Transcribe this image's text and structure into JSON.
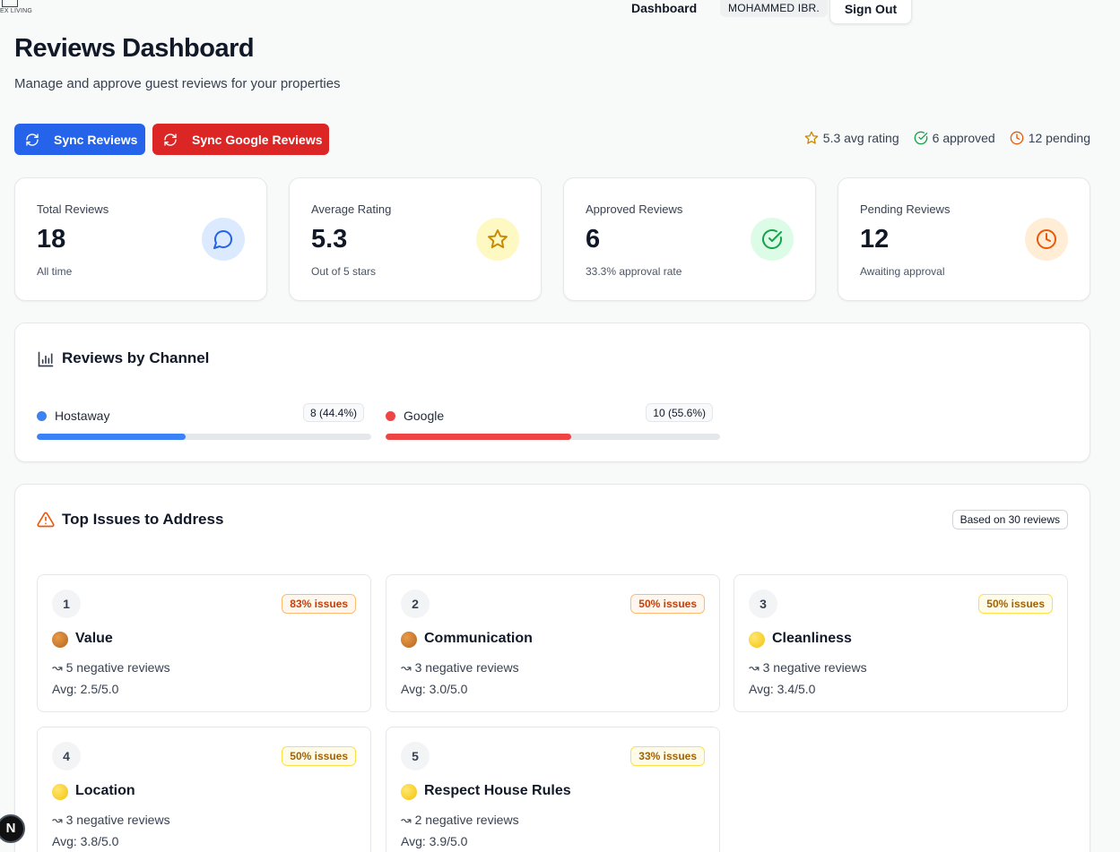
{
  "header": {
    "logo_text": "EX LIVING",
    "nav_dashboard": "Dashboard",
    "user_name": "MOHAMMED IBR.",
    "sign_out": "Sign Out"
  },
  "page": {
    "title": "Reviews Dashboard",
    "subtitle": "Manage and approve guest reviews for your properties"
  },
  "actions": {
    "sync_reviews": "Sync Reviews",
    "sync_google": "Sync Google Reviews"
  },
  "summary": {
    "avg_rating": "5.3 avg rating",
    "approved": "6 approved",
    "pending": "12 pending"
  },
  "stats": [
    {
      "label": "Total Reviews",
      "value": "18",
      "sub": "All time",
      "icon": "message-circle-icon",
      "color": "#2563eb",
      "bg": "#dbeafe"
    },
    {
      "label": "Average Rating",
      "value": "5.3",
      "sub": "Out of 5 stars",
      "icon": "star-icon",
      "color": "#ca8a04",
      "bg": "#fef9c3"
    },
    {
      "label": "Approved Reviews",
      "value": "6",
      "sub": "33.3% approval rate",
      "icon": "check-circle-icon",
      "color": "#16a34a",
      "bg": "#dcfce7"
    },
    {
      "label": "Pending Reviews",
      "value": "12",
      "sub": "Awaiting approval",
      "icon": "clock-icon",
      "color": "#ea580c",
      "bg": "#ffedd5"
    }
  ],
  "channels": {
    "title": "Reviews by Channel",
    "items": [
      {
        "name": "Hostaway",
        "count": "8 (44.4%)",
        "fraction": 0.444,
        "color": "#3b82f6"
      },
      {
        "name": "Google",
        "count": "10 (55.6%)",
        "fraction": 0.556,
        "color": "#ef4444"
      }
    ]
  },
  "issues": {
    "title": "Top Issues to Address",
    "based_on": "Based on 30 reviews",
    "items": [
      {
        "rank": "1",
        "pct": "83% issues",
        "severity": "orange",
        "name": "Value",
        "neg": "↝ 5 negative reviews",
        "avg": "Avg: 2.5/5.0"
      },
      {
        "rank": "2",
        "pct": "50% issues",
        "severity": "orange",
        "name": "Communication",
        "neg": "↝ 3 negative reviews",
        "avg": "Avg: 3.0/5.0"
      },
      {
        "rank": "3",
        "pct": "50% issues",
        "severity": "yellow",
        "name": "Cleanliness",
        "neg": "↝ 3 negative reviews",
        "avg": "Avg: 3.4/5.0"
      },
      {
        "rank": "4",
        "pct": "50% issues",
        "severity": "yellow",
        "name": "Location",
        "neg": "↝ 3 negative reviews",
        "avg": "Avg: 3.8/5.0"
      },
      {
        "rank": "5",
        "pct": "33% issues",
        "severity": "yellow",
        "name": "Respect House Rules",
        "neg": "↝ 2 negative reviews",
        "avg": "Avg: 3.9/5.0"
      }
    ]
  },
  "next_badge": "N"
}
